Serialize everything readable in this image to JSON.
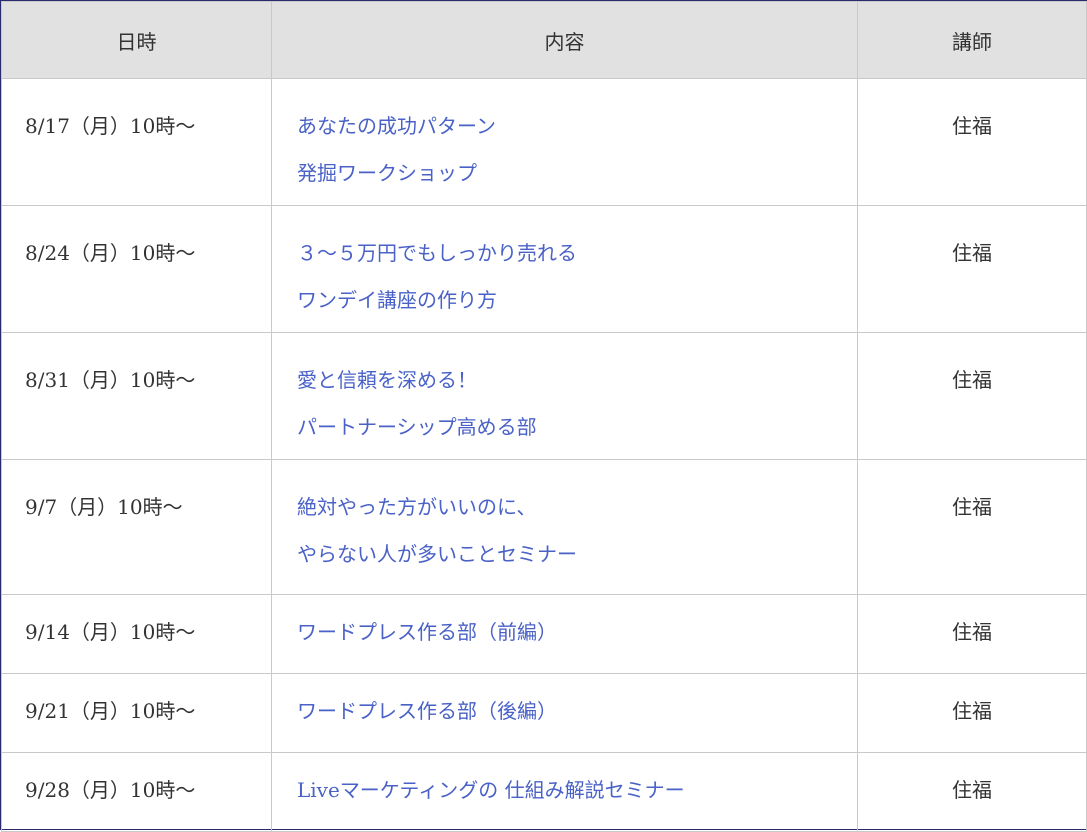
{
  "table": {
    "headers": {
      "date": "日時",
      "content": "内容",
      "teacher": "講師"
    },
    "rows": [
      {
        "date": "8/17（月）10時〜",
        "content_lines": [
          "あなたの成功パターン",
          "発掘ワークショップ"
        ],
        "teacher": "住福"
      },
      {
        "date": "8/24（月）10時〜",
        "content_lines": [
          "３〜５万円でもしっかり売れる",
          "ワンデイ講座の作り方"
        ],
        "teacher": "住福"
      },
      {
        "date": "8/31（月）10時〜",
        "content_lines": [
          "愛と信頼を深める！",
          "パートナーシップ高める部"
        ],
        "teacher": "住福"
      },
      {
        "date": "9/7（月）10時〜",
        "content_lines": [
          "絶対やった方がいいのに、",
          "やらない人が多いことセミナー"
        ],
        "teacher": "住福"
      },
      {
        "date": "9/14（月）10時〜",
        "content_lines": [
          "ワードプレス作る部（前編）"
        ],
        "teacher": "住福"
      },
      {
        "date": "9/21（月）10時〜",
        "content_lines": [
          "ワードプレス作る部（後編）"
        ],
        "teacher": "住福"
      },
      {
        "date": "9/28（月）10時〜",
        "content_lines": [
          "Liveマーケティングの 仕組み解説セミナー"
        ],
        "teacher": "住福"
      }
    ]
  },
  "colors": {
    "header_bg": "#e1e1e1",
    "border": "#c9c9c9",
    "link": "#4a62c7",
    "text": "#333333"
  }
}
